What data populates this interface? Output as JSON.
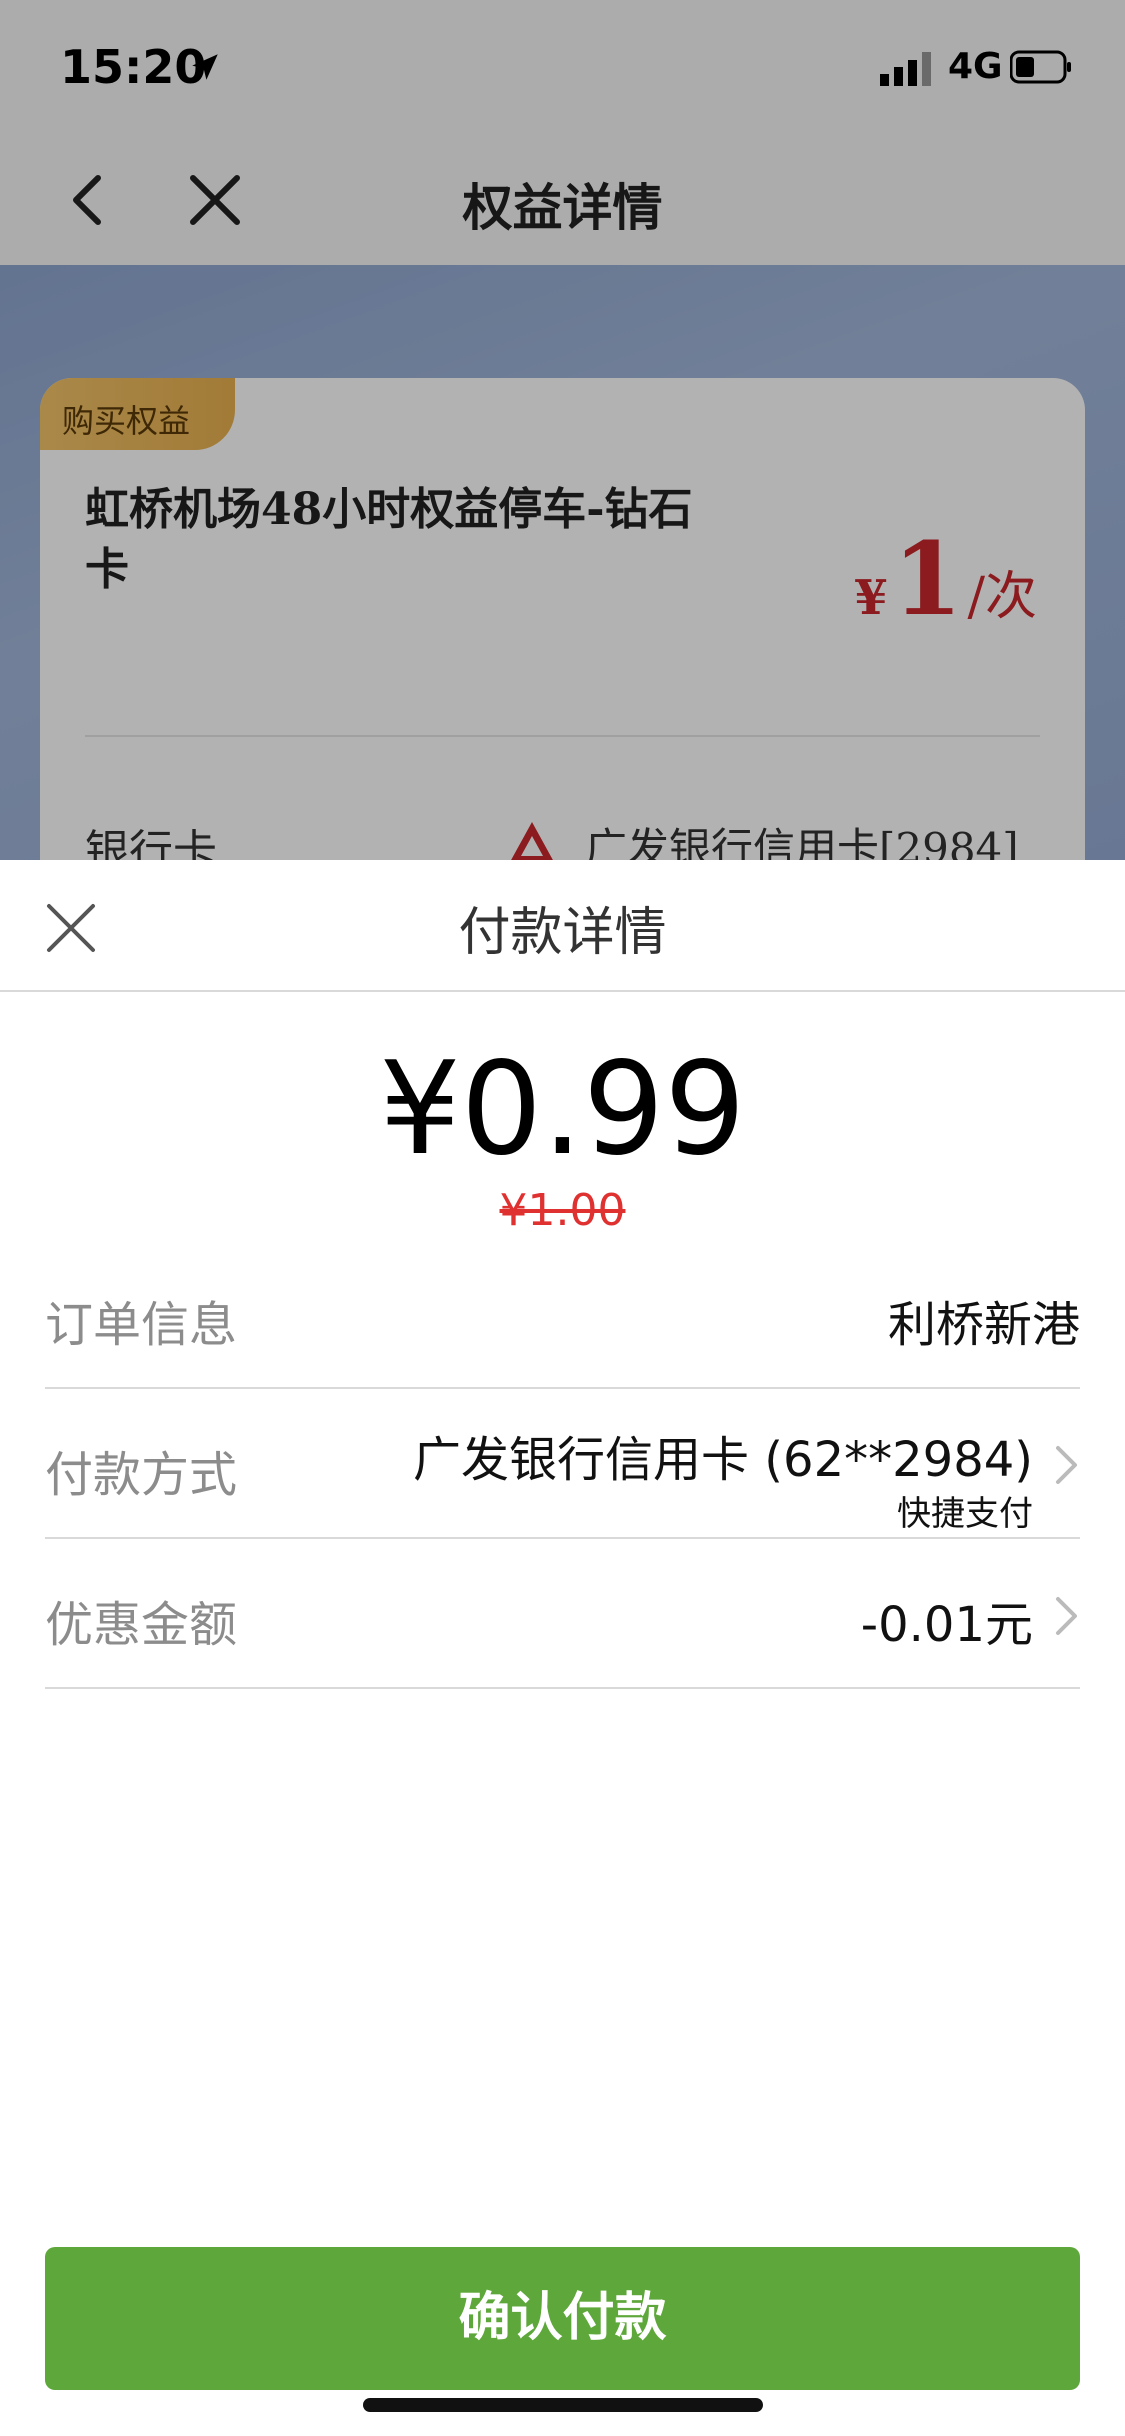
{
  "status_bar": {
    "time": "15:20",
    "network": "4G"
  },
  "nav": {
    "title": "权益详情"
  },
  "card": {
    "tag": "购买权益",
    "name": "虹桥机场48小时权益停车-钻石卡",
    "price_symbol": "¥",
    "price_value": "1",
    "price_unit": "/次",
    "bank_label": "银行卡",
    "bank_value": "广发银行信用卡[2984]"
  },
  "sheet": {
    "title": "付款详情",
    "amount": "¥0.99",
    "original_amount": "¥1.00",
    "rows": [
      {
        "label": "订单信息",
        "value": "利桥新港"
      },
      {
        "label": "付款方式",
        "value": "广发银行信用卡 (62**2984)",
        "sub": "快捷支付"
      },
      {
        "label": "优惠金额",
        "value": "-0.01元"
      }
    ],
    "confirm_label": "确认付款"
  },
  "colors": {
    "accent_green": "#5ea73a",
    "price_red": "#c8282c",
    "strike_red": "#e03131",
    "tag_gold": "#f3c46a"
  }
}
